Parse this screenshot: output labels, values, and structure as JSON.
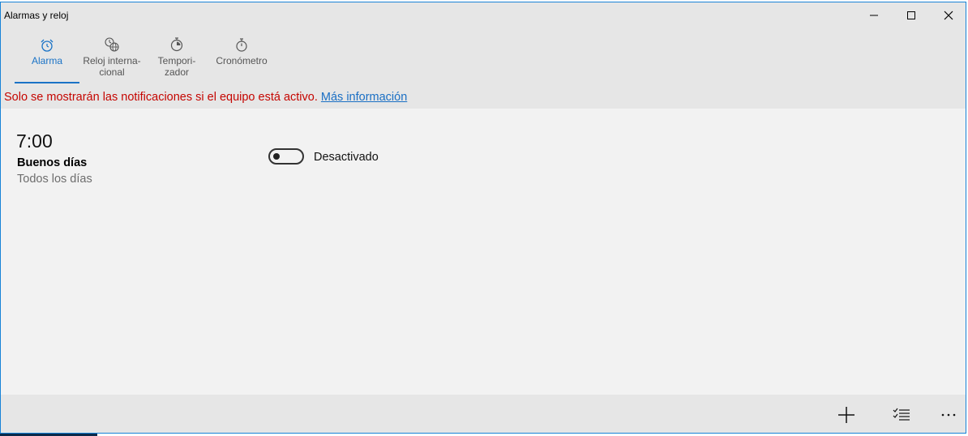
{
  "window": {
    "title": "Alarmas y reloj"
  },
  "tabs": [
    {
      "label": "Alarma",
      "icon": "alarm-clock-icon",
      "active": true
    },
    {
      "label": "Reloj interna-\ncional",
      "icon": "world-clock-icon",
      "active": false
    },
    {
      "label": "Tempori-\nzador",
      "icon": "timer-icon",
      "active": false
    },
    {
      "label": "Cronómetro",
      "icon": "stopwatch-icon",
      "active": false
    }
  ],
  "notice": {
    "text": "Solo se mostrarán las notificaciones si el equipo está activo.",
    "link": "Más información"
  },
  "alarm": {
    "time": "7:00",
    "name": "Buenos días",
    "days": "Todos los días",
    "state_label": "Desactivado",
    "enabled": false
  },
  "bottom_bar": {
    "buttons": [
      "add-icon",
      "select-list-icon",
      "more-icon"
    ]
  },
  "colors": {
    "accent": "#1a73c6",
    "warning": "#c50500",
    "titlebar_bg": "#e6e6e6",
    "content_bg": "#f2f2f2"
  }
}
